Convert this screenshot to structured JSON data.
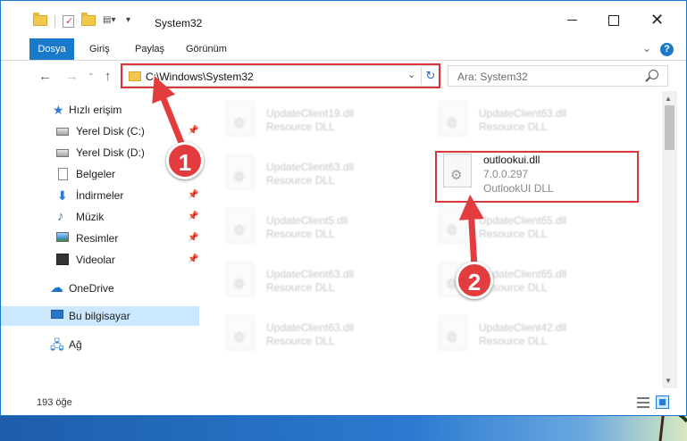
{
  "window": {
    "title": "System32",
    "min_label": "",
    "max_label": "",
    "close_label": "✕"
  },
  "ribbon": {
    "tabs": [
      "Dosya",
      "Giriş",
      "Paylaş",
      "Görünüm"
    ],
    "help": "?"
  },
  "address": {
    "path": "C:\\Windows\\System32",
    "search_placeholder": "Ara: System32"
  },
  "nav": {
    "items": [
      {
        "label": "Hızlı erişim",
        "icon": "star-icon"
      },
      {
        "label": "Yerel Disk (C:)",
        "icon": "drive-icon",
        "pinned": true
      },
      {
        "label": "Yerel Disk (D:)",
        "icon": "drive-icon"
      },
      {
        "label": "Belgeler",
        "icon": "documents-icon",
        "pinned": true
      },
      {
        "label": "İndirmeler",
        "icon": "downloads-icon",
        "pinned": true
      },
      {
        "label": "Müzik",
        "icon": "music-icon",
        "pinned": true
      },
      {
        "label": "Resimler",
        "icon": "pictures-icon",
        "pinned": true
      },
      {
        "label": "Videolar",
        "icon": "videos-icon",
        "pinned": true
      },
      {
        "label": "OneDrive",
        "icon": "onedrive-icon"
      },
      {
        "label": "Bu bilgisayar",
        "icon": "this-pc-icon",
        "selected": true
      },
      {
        "label": "Ağ",
        "icon": "network-icon"
      }
    ]
  },
  "files": [
    {
      "name": "UpdateClient19.dll",
      "desc": "Resource DLL",
      "blurred": true
    },
    {
      "name": "UpdateClient63.dll",
      "desc": "Resource DLL",
      "blurred": true
    },
    {
      "name": "UpdateClient63.dll",
      "desc": "Resource DLL",
      "blurred": true
    },
    {
      "name": "outlookui.dll",
      "version": "7.0.0.297",
      "desc": "OutlookUI DLL",
      "blurred": false
    },
    {
      "name": "UpdateClient5.dll",
      "desc": "Resource DLL",
      "blurred": true
    },
    {
      "name": "UpdateClient65.dll",
      "desc": "Resource DLL",
      "blurred": true
    },
    {
      "name": "UpdateClient63.dll",
      "desc": "Resource DLL",
      "blurred": true
    },
    {
      "name": "UpdateClient65.dll",
      "desc": "Resource DLL",
      "blurred": true
    },
    {
      "name": "UpdateClient63.dll",
      "desc": "Resource DLL",
      "blurred": true
    },
    {
      "name": "UpdateClient42.dll",
      "desc": "Resource DLL",
      "blurred": true
    }
  ],
  "status": {
    "count": "193 öğe"
  },
  "annotations": {
    "step1": "1",
    "step2": "2",
    "color": "#e23c3f"
  }
}
